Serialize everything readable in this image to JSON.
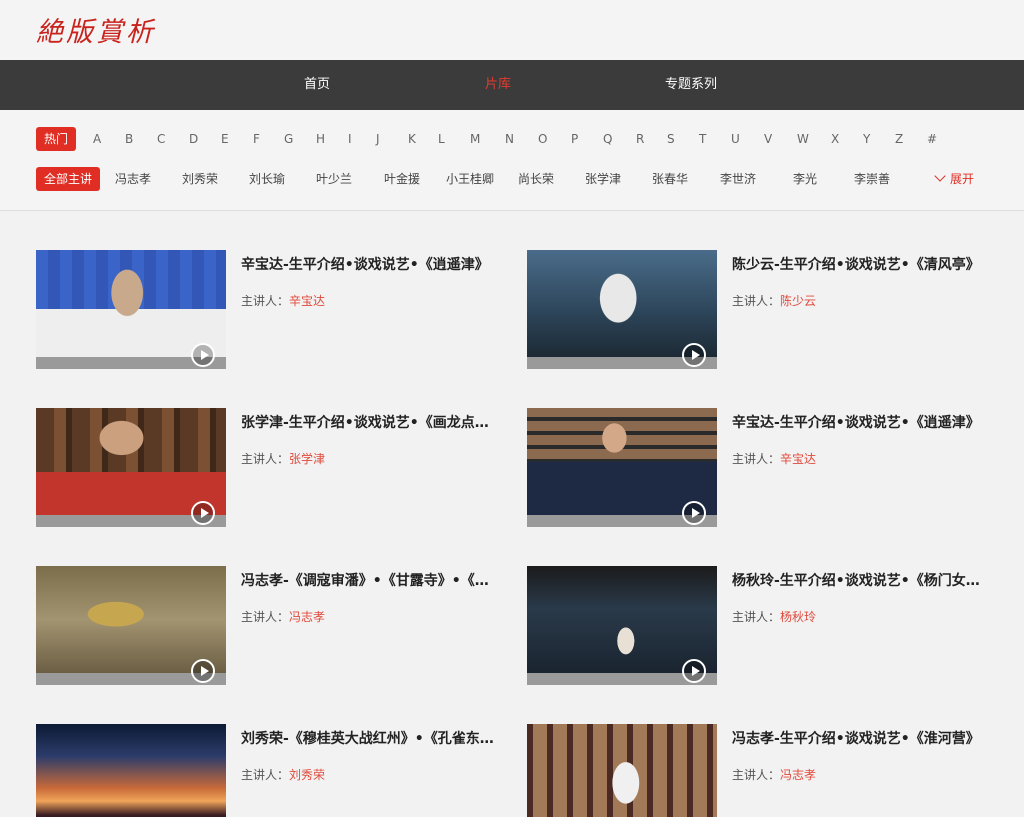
{
  "logo": "絶版賞析",
  "nav": [
    {
      "label": "首页",
      "active": false
    },
    {
      "label": "片库",
      "active": true
    },
    {
      "label": "专题系列",
      "active": false
    }
  ],
  "letters": [
    "热门",
    "A",
    "B",
    "C",
    "D",
    "E",
    "F",
    "G",
    "H",
    "I",
    "J",
    "K",
    "L",
    "M",
    "N",
    "O",
    "P",
    "Q",
    "R",
    "S",
    "T",
    "U",
    "V",
    "W",
    "X",
    "Y",
    "Z",
    "#"
  ],
  "people": [
    "全部主讲",
    "冯志孝",
    "刘秀荣",
    "刘长瑜",
    "叶少兰",
    "叶金援",
    "小王桂卿",
    "尚长荣",
    "张学津",
    "张春华",
    "李世济",
    "李光",
    "李崇善"
  ],
  "expand_label": "展开",
  "speaker_prefix": "主讲人：",
  "videos": [
    {
      "title": "辛宝达-生平介绍•谈戏说艺•《逍遥津》",
      "speaker": "辛宝达",
      "thumb": "opera-performer-blue"
    },
    {
      "title": "陈少云-生平介绍•谈戏说艺•《清风亭》",
      "speaker": "陈少云",
      "thumb": "opera-stage-subtitle"
    },
    {
      "title": "张学津-生平介绍•谈戏说艺•《画龙点睛》",
      "speaker": "张学津",
      "thumb": "interview-bookshelf"
    },
    {
      "title": "辛宝达-生平介绍•谈戏说艺•《逍遥津》",
      "speaker": "辛宝达",
      "thumb": "interview-suit"
    },
    {
      "title": "冯志孝-《调寇审潘》•《甘露寺》•《失空斩》",
      "speaker": "冯志孝",
      "thumb": "ornament-pattern"
    },
    {
      "title": "杨秋玲-生平介绍•谈戏说艺•《杨门女将》",
      "speaker": "杨秋玲",
      "thumb": "dark-stage-dancer"
    },
    {
      "title": "刘秀荣-《穆桂英大战红州》•《孔雀东南飞》",
      "speaker": "刘秀荣",
      "thumb": "sunset-sky"
    },
    {
      "title": "冯志孝-生平介绍•谈戏说艺•《淮河营》",
      "speaker": "冯志孝",
      "thumb": "opera-elder-window"
    }
  ]
}
